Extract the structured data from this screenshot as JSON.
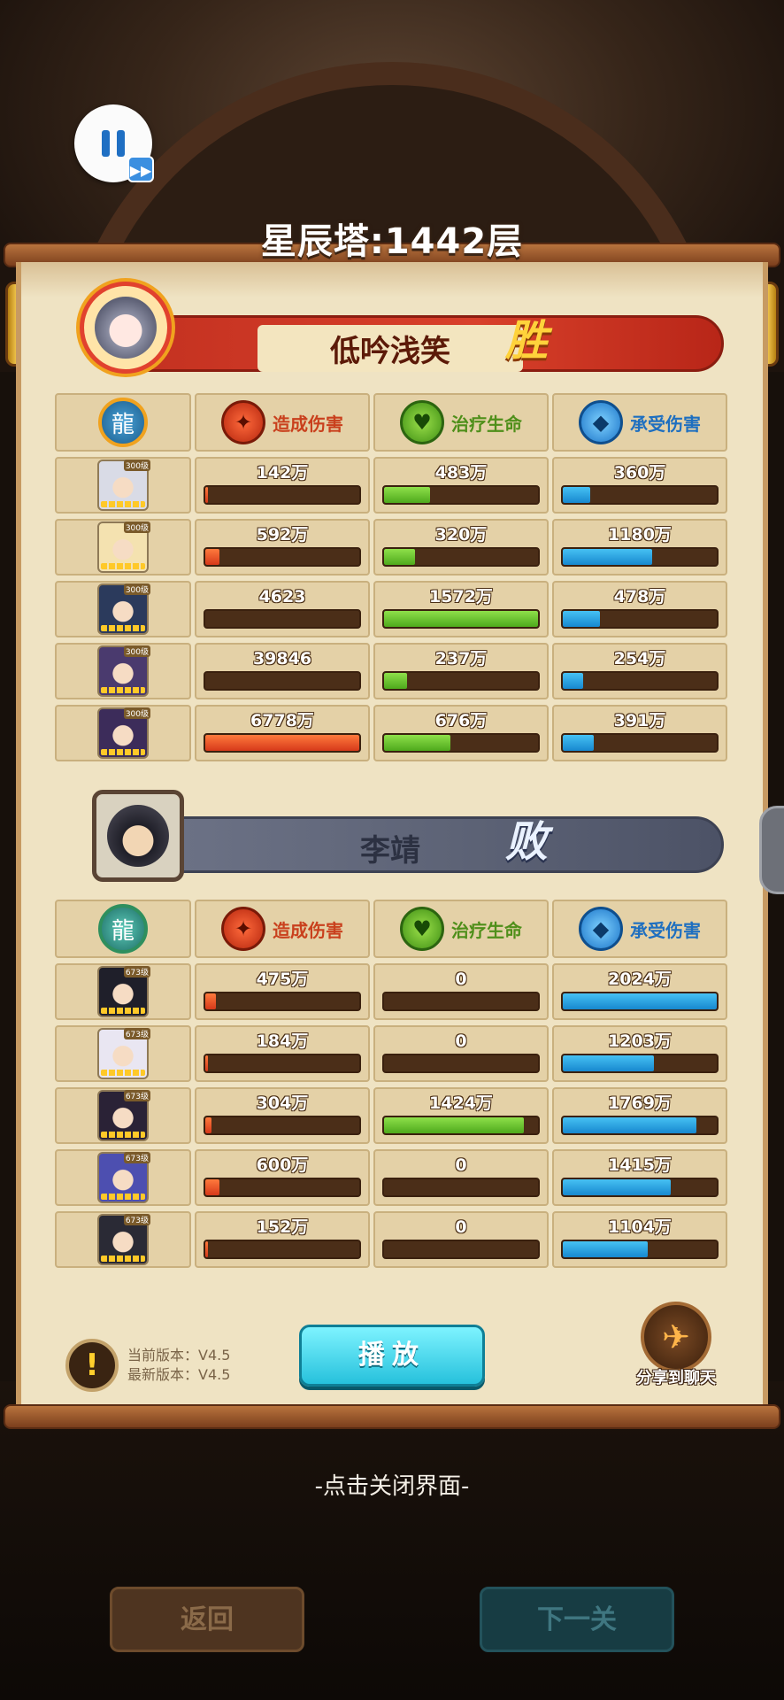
{
  "title": "星辰塔:1442层",
  "controls": {
    "pause_icon": "pause-icon",
    "fast_forward_icon": "fast-forward-icon",
    "ff_glyph": "▶▶"
  },
  "headers": {
    "damage": "造成伤害",
    "heal": "治疗生命",
    "taken": "承受伤害"
  },
  "teams": [
    {
      "name": "低吟浅笑",
      "result": "胜",
      "rows": [
        {
          "level": "300级",
          "damage": "142万",
          "damage_pct": 2,
          "heal": "483万",
          "heal_pct": 30,
          "taken": "360万",
          "taken_pct": 18
        },
        {
          "level": "300级",
          "damage": "592万",
          "damage_pct": 9,
          "heal": "320万",
          "heal_pct": 20,
          "taken": "1180万",
          "taken_pct": 58
        },
        {
          "level": "300级",
          "damage": "4623",
          "damage_pct": 0,
          "heal": "1572万",
          "heal_pct": 100,
          "taken": "478万",
          "taken_pct": 24
        },
        {
          "level": "300级",
          "damage": "39846",
          "damage_pct": 0,
          "heal": "237万",
          "heal_pct": 15,
          "taken": "254万",
          "taken_pct": 13
        },
        {
          "level": "300级",
          "damage": "6778万",
          "damage_pct": 100,
          "heal": "676万",
          "heal_pct": 43,
          "taken": "391万",
          "taken_pct": 20
        }
      ]
    },
    {
      "name": "李靖",
      "result": "败",
      "rows": [
        {
          "level": "673级",
          "damage": "475万",
          "damage_pct": 7,
          "heal": "0",
          "heal_pct": 0,
          "taken": "2024万",
          "taken_pct": 100
        },
        {
          "level": "673级",
          "damage": "184万",
          "damage_pct": 2,
          "heal": "0",
          "heal_pct": 0,
          "taken": "1203万",
          "taken_pct": 59
        },
        {
          "level": "673级",
          "damage": "304万",
          "damage_pct": 4,
          "heal": "1424万",
          "heal_pct": 91,
          "taken": "1769万",
          "taken_pct": 87
        },
        {
          "level": "673级",
          "damage": "600万",
          "damage_pct": 9,
          "heal": "0",
          "heal_pct": 0,
          "taken": "1415万",
          "taken_pct": 70
        },
        {
          "level": "673级",
          "damage": "152万",
          "damage_pct": 2,
          "heal": "0",
          "heal_pct": 0,
          "taken": "1104万",
          "taken_pct": 55
        }
      ]
    }
  ],
  "hero_colors": [
    "#d9dbe6",
    "#f4e2b0",
    "#2b3a5c",
    "#4a3a6e",
    "#3c2c5a",
    "#1f1f2a",
    "#e9e6f2",
    "#2a2236",
    "#4d4fb0",
    "#2a2a35"
  ],
  "footer": {
    "current_version": "当前版本：V4.5",
    "latest_version": "最新版本：V4.5",
    "warn_glyph": "!",
    "play": "播放",
    "share_glyph": "✈",
    "share": "分享到聊天",
    "close_hint": "-点击关闭界面-"
  },
  "bottom_buttons": {
    "back": "返回",
    "next": "下一关"
  },
  "colors": {
    "damage": "#d6391a",
    "heal": "#4ea91c",
    "taken": "#1788cf",
    "win": "#c23020",
    "lose": "#5c6275"
  }
}
